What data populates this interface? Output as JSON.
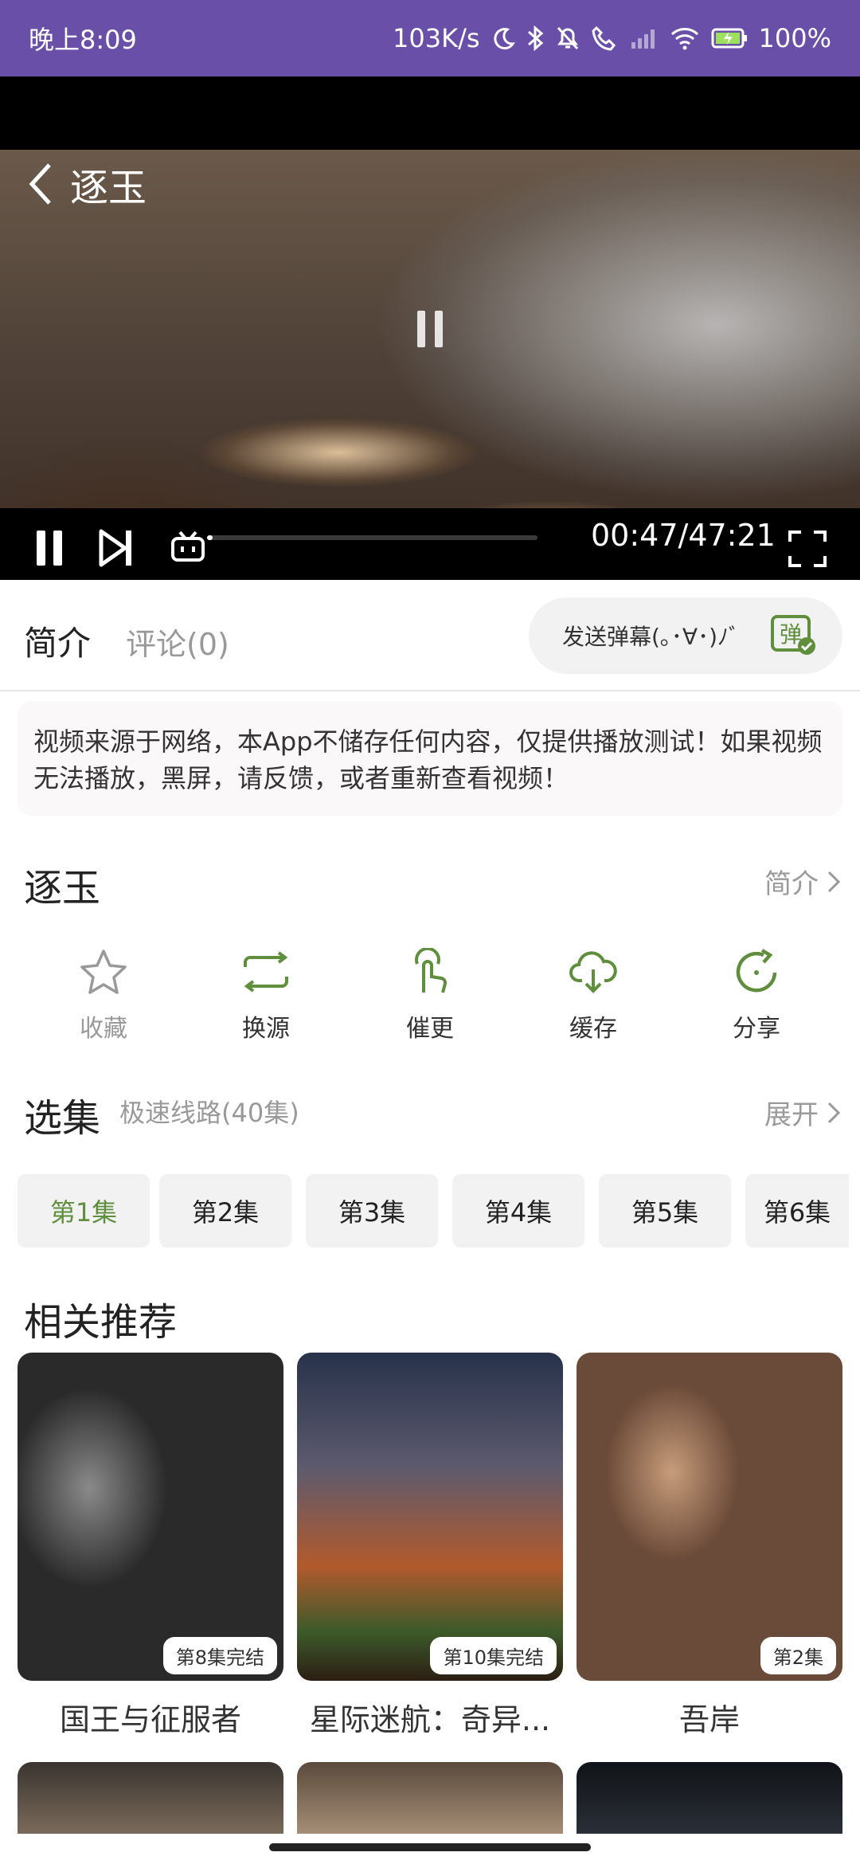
{
  "status": {
    "time": "晚上8:09",
    "network_speed": "103K/s",
    "battery": "100%"
  },
  "player": {
    "title": "逐玉",
    "time_display": "00:47/47:21",
    "progress": 0.0166
  },
  "tabs": {
    "intro": "简介",
    "comments": "评论(0)"
  },
  "danmaku": {
    "placeholder": "发送弹幕(｡･∀･)ﾉﾞ",
    "button_label": "弹"
  },
  "notice": "视频来源于网络，本App不储存任何内容，仅提供播放测试！如果视频无法播放，黑屏，请反馈，或者重新查看视频！",
  "title_row": {
    "title": "逐玉",
    "intro_link": "简介"
  },
  "actions": [
    {
      "label": "收藏",
      "icon": "star-icon"
    },
    {
      "label": "换源",
      "icon": "swap-icon"
    },
    {
      "label": "催更",
      "icon": "tap-hand-icon"
    },
    {
      "label": "缓存",
      "icon": "cloud-download-icon"
    },
    {
      "label": "分享",
      "icon": "share-refresh-icon"
    }
  ],
  "episodes_section": {
    "title": "选集",
    "line_info": "极速线路(40集)",
    "expand": "展开",
    "episodes": [
      "第1集",
      "第2集",
      "第3集",
      "第4集",
      "第5集",
      "第6集"
    ],
    "active_index": 0
  },
  "recommend": {
    "title": "相关推荐",
    "items": [
      {
        "title": "国王与征服者",
        "badge": "第8集完结"
      },
      {
        "title": "星际迷航：奇异...",
        "badge": "第10集完结"
      },
      {
        "title": "吾岸",
        "badge": "第2集"
      }
    ]
  },
  "colors": {
    "status_bar": "#6a4fa8",
    "accent_green": "#5f8f3c"
  }
}
